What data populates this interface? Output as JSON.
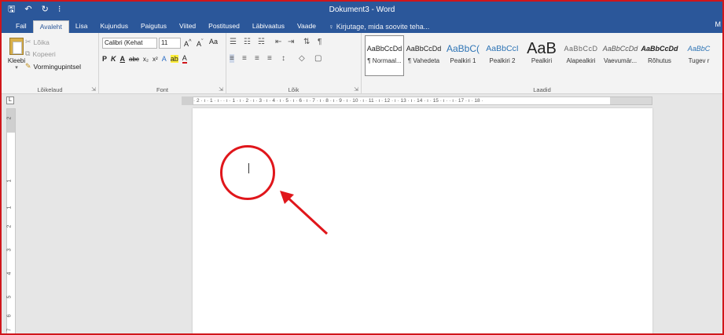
{
  "window": {
    "title": "Dokument3 - Word"
  },
  "qat": {
    "save_icon": "save-icon",
    "undo_icon": "undo-icon",
    "redo_icon": "redo-icon",
    "customize_icon": "customize-qat-icon"
  },
  "tabs": [
    {
      "label": "Fail"
    },
    {
      "label": "Avaleht"
    },
    {
      "label": "Lisa"
    },
    {
      "label": "Kujundus"
    },
    {
      "label": "Paigutus"
    },
    {
      "label": "Viited"
    },
    {
      "label": "Postitused"
    },
    {
      "label": "Läbivaatus"
    },
    {
      "label": "Vaade"
    }
  ],
  "tell_me": {
    "placeholder": "Kirjutage, mida soovite teha..."
  },
  "tabs_right": {
    "label": "M"
  },
  "clipboard": {
    "paste_label": "Kleebi",
    "cut_label": "Lõika",
    "copy_label": "Kopeeri",
    "format_painter_label": "Vormingupintsel",
    "group_label": "Lõikelaud"
  },
  "font": {
    "name": "Calibri (Kehat",
    "size": "11",
    "group_label": "Font"
  },
  "paragraph": {
    "group_label": "Lõik"
  },
  "styles": {
    "group_label": "Laadid",
    "items": [
      {
        "sample": "AaBbCcDd",
        "name": "¶ Normaal..."
      },
      {
        "sample": "AaBbCcDd",
        "name": "¶ Vahedeta"
      },
      {
        "sample": "AaBbC(",
        "name": "Pealkiri 1"
      },
      {
        "sample": "AaBbCcI",
        "name": "Pealkiri 2"
      },
      {
        "sample": "AaB",
        "name": "Pealkiri"
      },
      {
        "sample": "AaBbCcD",
        "name": "Alapealkiri"
      },
      {
        "sample": "AaBbCcDd",
        "name": "Vaevumär..."
      },
      {
        "sample": "AaBbCcDd",
        "name": "Rõhutus"
      },
      {
        "sample": "AaBbC",
        "name": "Tugev r"
      }
    ]
  },
  "ruler": {
    "corner_label": "L",
    "marks": "· 2 · ı · 1 · ı ·  · ı · 1 · ı · 2 · ı · 3 · ı · 4 · ı · 5 · ı · 6 · ı · 7 · ı · 8 · ı · 9 · ı · 10 · ı · 11 · ı · 12 · ı · 13 · ı · 14 · ı · 15 · ı ·  · ı · 17 · ı · 18 ·",
    "vertical_numbers": [
      "2",
      "1",
      "1",
      "2",
      "3",
      "4",
      "5",
      "6",
      "7"
    ]
  },
  "colors": {
    "word_blue": "#2b579a",
    "annotation_red": "#e0161b",
    "frame_red": "#d0161b"
  }
}
